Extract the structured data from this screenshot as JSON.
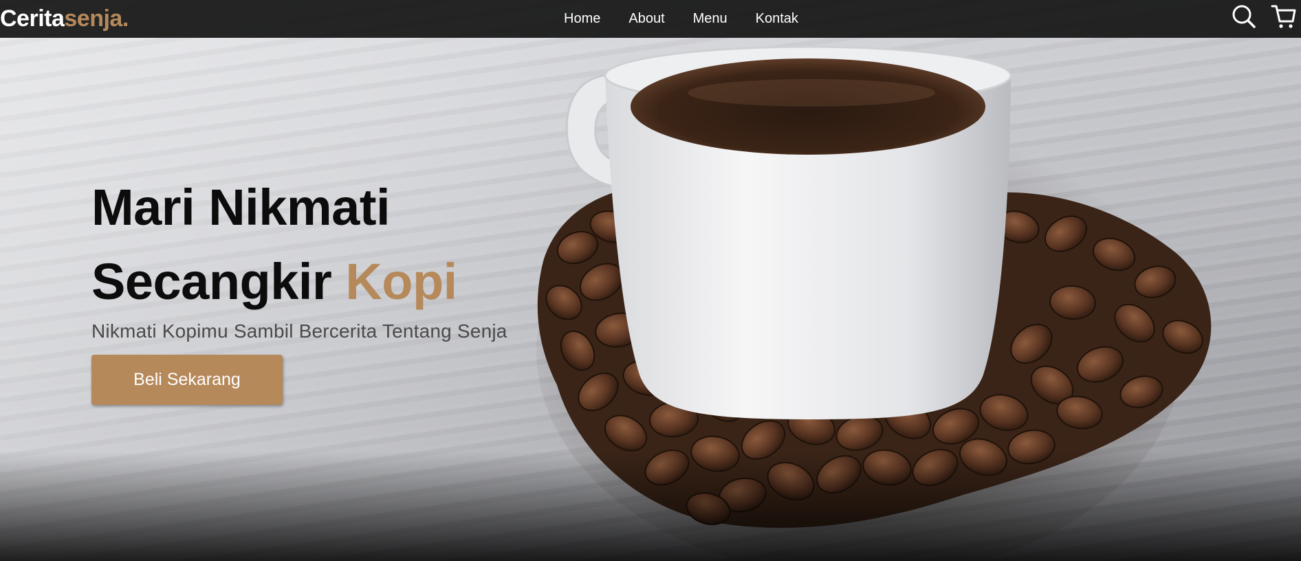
{
  "navbar": {
    "logo": {
      "primary": "Cerita",
      "accent": "senja."
    },
    "links": [
      {
        "label": "Home"
      },
      {
        "label": "About"
      },
      {
        "label": "Menu"
      },
      {
        "label": "Kontak"
      }
    ],
    "icons": {
      "search": "search-icon",
      "cart": "shopping-cart-icon"
    }
  },
  "hero": {
    "headline_line1": "Mari Nikmati",
    "headline_line2_plain": "Secangkir",
    "headline_line2_accent": "Kopi",
    "tagline": "Nikmati Kopimu Sambil Bercerita Tentang Senja",
    "cta_label": "Beli Sekarang",
    "image": "coffee-cup-with-beans-photo"
  },
  "colors": {
    "accent": "#b6895b",
    "navbar_bg": "#141414",
    "headline": "#0c0c0c",
    "text_light": "#ffffff"
  }
}
